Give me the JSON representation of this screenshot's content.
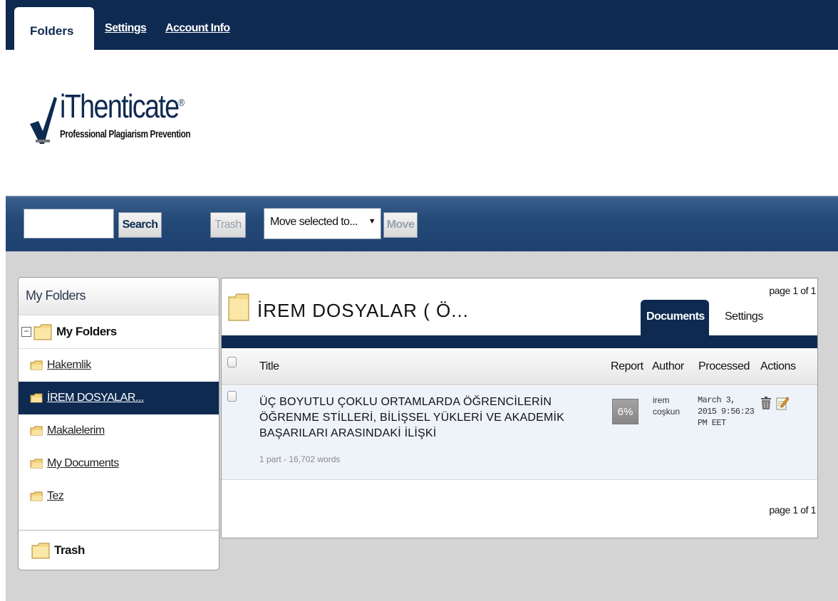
{
  "topnav": {
    "tab_folders": "Folders",
    "link_settings": "Settings",
    "link_account": "Account Info"
  },
  "logo": {
    "brand": "iThenticate",
    "reg": "®",
    "tagline": "Professional Plagiarism Prevention"
  },
  "toolbar": {
    "search_value": "",
    "search_label": "Search",
    "trash_label": "Trash",
    "move_select": "Move selected to...",
    "move_label": "Move"
  },
  "sidebar": {
    "header": "My Folders",
    "root": "My Folders",
    "items": [
      {
        "label": "Hakemlik"
      },
      {
        "label": "İREM DOSYALAR..."
      },
      {
        "label": "Makalelerim"
      },
      {
        "label": "My Documents"
      },
      {
        "label": "Tez"
      }
    ],
    "selected_index": 1,
    "trash": "Trash"
  },
  "main": {
    "folder_title": "İREM DOSYALAR ( Ö...",
    "page_top": "page 1 of 1",
    "page_bottom": "page 1 of 1",
    "tabs": [
      "Documents",
      "Settings"
    ],
    "columns": [
      "Title",
      "Report",
      "Author",
      "Processed",
      "Actions"
    ],
    "rows": [
      {
        "title": "ÜÇ BOYUTLU ÇOKLU ORTAMLARDA ÖĞRENCİLERİN ÖĞRENME STİLLERİ, BİLİŞSEL YÜKLERİ VE AKADEMİK BAŞARILARI ARASINDAKİ İLİŞKİ",
        "meta": "1 part - 16,702 words",
        "report": "6%",
        "author_line1": "irem",
        "author_line2": "coşkun",
        "processed_line1": "March 3,",
        "processed_line2": "2015 9:56:23",
        "processed_line3": "PM EET",
        "action_icons": [
          "trash-icon",
          "edit-icon"
        ]
      }
    ]
  },
  "colors": {
    "navy": "#0e2a50",
    "content_bg": "#d4d4d4",
    "row_bg": "#eef3fa"
  }
}
